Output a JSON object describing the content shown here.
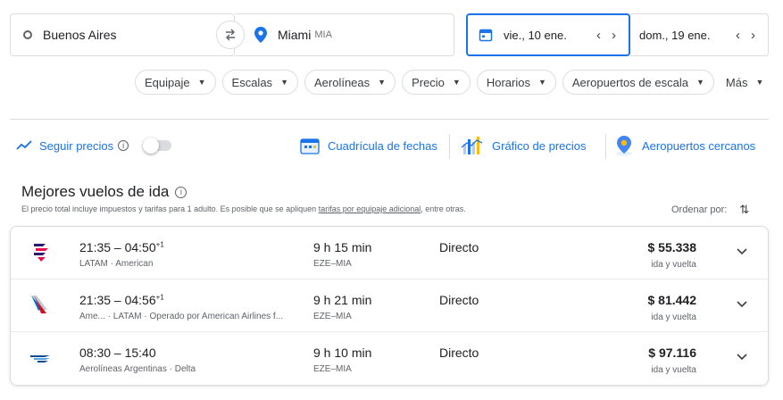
{
  "search": {
    "origin": "Buenos Aires",
    "destination": "Miami",
    "destination_code": "MIA",
    "depart_date": "vie., 10 ene.",
    "return_date": "dom., 19 ene."
  },
  "filters": [
    {
      "label": "Equipaje"
    },
    {
      "label": "Escalas"
    },
    {
      "label": "Aerolíneas"
    },
    {
      "label": "Precio"
    },
    {
      "label": "Horarios"
    },
    {
      "label": "Aeropuertos de escala"
    },
    {
      "label": "Más"
    }
  ],
  "tools": {
    "track_prices": "Seguir precios",
    "date_grid": "Cuadrícula de fechas",
    "price_graph": "Gráfico de precios",
    "nearby_airports": "Aeropuertos cercanos"
  },
  "section": {
    "title": "Mejores vuelos de ida",
    "note_prefix": "El precio total incluye impuestos y tarifas para 1 adulto. Es posible que se apliquen ",
    "note_link": "tarifas por equipaje adicional",
    "note_suffix": ", entre otras.",
    "sort_label": "Ordenar por:"
  },
  "flights": [
    {
      "time_range": "21:35 – 04:50",
      "day_offset": "+1",
      "airlines": "LATAM · American",
      "duration": "9 h 15 min",
      "route": "EZE–MIA",
      "stops": "Directo",
      "price": "$ 55.338",
      "price_type": "ida y vuelta",
      "logo": "latam-logo"
    },
    {
      "time_range": "21:35 – 04:56",
      "day_offset": "+1",
      "airlines": "Ame... · LATAM · Operado por American Airlines f...",
      "duration": "9 h 21 min",
      "route": "EZE–MIA",
      "stops": "Directo",
      "price": "$ 81.442",
      "price_type": "ida y vuelta",
      "logo": "american-airlines-logo"
    },
    {
      "time_range": "08:30 – 15:40",
      "day_offset": "",
      "airlines": "Aerolíneas Argentinas · Delta",
      "duration": "9 h 10 min",
      "route": "EZE–MIA",
      "stops": "Directo",
      "price": "$ 97.116",
      "price_type": "ida y vuelta",
      "logo": "aerolineas-argentinas-logo"
    }
  ],
  "colors": {
    "accent": "#1a73e8",
    "border": "#dadce0",
    "latam_navy": "#2b1b6e",
    "latam_red": "#e8114b",
    "american_red": "#c8102e",
    "american_blue": "#0078d2"
  }
}
